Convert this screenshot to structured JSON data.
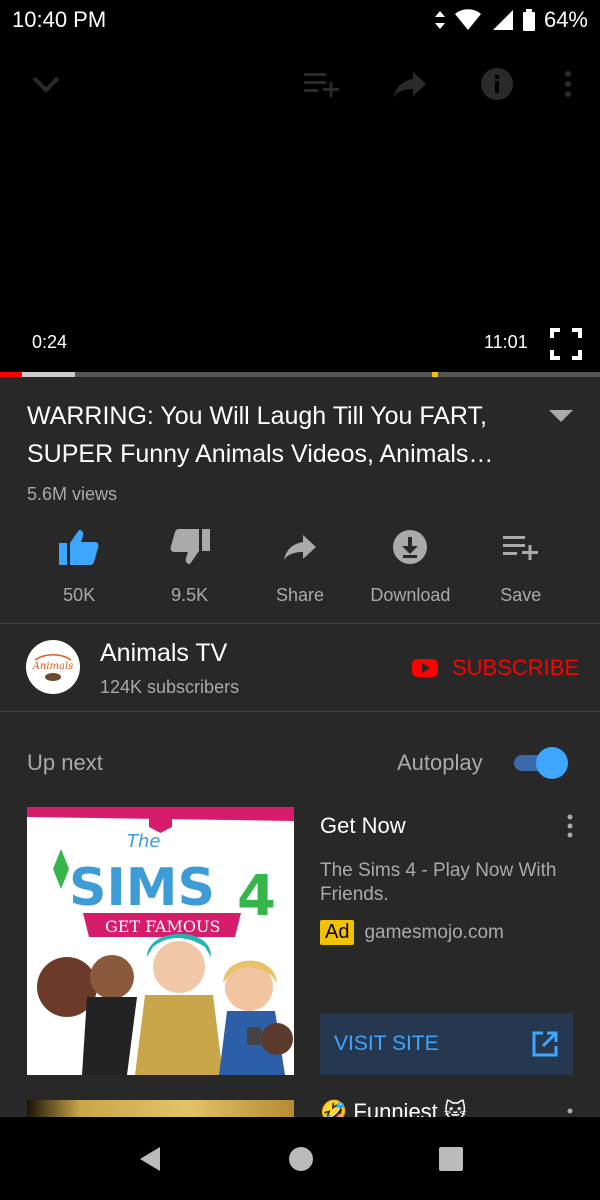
{
  "status_bar": {
    "time": "10:40 PM",
    "battery": "64%",
    "icons": [
      "data-arrows-icon",
      "wifi-icon",
      "cell-signal-icon",
      "battery-icon"
    ]
  },
  "player": {
    "current_time": "0:24",
    "duration": "11:01",
    "played_fraction": 0.036,
    "top_icons": [
      "collapse-chevron-icon",
      "add-to-queue-icon",
      "share-icon",
      "info-icon",
      "more-vert-icon"
    ]
  },
  "video": {
    "title": "WARRING: You Will Laugh Till You FART, SUPER Funny Animals Videos, Animals…",
    "views": "5.6M views"
  },
  "actions": [
    {
      "label": "50K",
      "icon": "thumbs-up-icon"
    },
    {
      "label": "9.5K",
      "icon": "thumbs-down-icon"
    },
    {
      "label": "Share",
      "icon": "share-icon"
    },
    {
      "label": "Download",
      "icon": "download-icon"
    },
    {
      "label": "Save",
      "icon": "add-to-playlist-icon"
    }
  ],
  "channel": {
    "name": "Animals TV",
    "subscribers": "124K subscribers",
    "avatar_text": "Animals",
    "subscribe_label": "SUBSCRIBE"
  },
  "up_next": {
    "label": "Up next",
    "autoplay_label": "Autoplay",
    "autoplay_on": true
  },
  "ad": {
    "title": "Get Now",
    "description": "The Sims 4 - Play Now With Friends.",
    "badge": "Ad",
    "domain": "gamesmojo.com",
    "cta": "VISIT SITE",
    "thumb_text": {
      "the": "The",
      "sims": "SIMS",
      "four": "4",
      "banner": "GET FAMOUS"
    }
  },
  "next_video": {
    "title": "Funniest",
    "emoji_before": "🤣",
    "emoji_after": "🐱"
  },
  "colors": {
    "accent_red": "#ff0000",
    "accent_blue": "#3ea6ff",
    "panel_bg": "#282828",
    "ad_yellow": "#f2c200"
  }
}
